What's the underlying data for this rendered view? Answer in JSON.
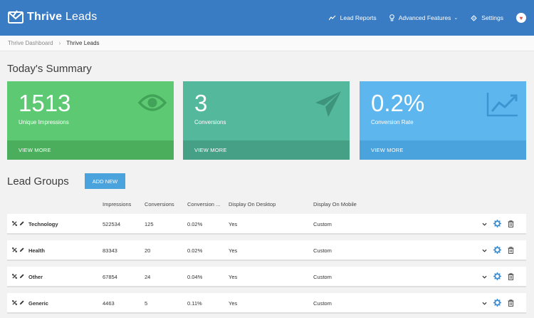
{
  "header": {
    "logo_bold": "Thrive",
    "logo_light": " Leads",
    "nav": [
      {
        "label": "Lead Reports",
        "icon": "chart-line-icon"
      },
      {
        "label": "Advanced Features",
        "icon": "lightbulb-icon"
      },
      {
        "label": "Settings",
        "icon": "gear-icon"
      }
    ],
    "avatar_icon": "heart-icon"
  },
  "breadcrumb": {
    "parent": "Thrive Dashboard",
    "separator": "›",
    "current": "Thrive Leads"
  },
  "summary": {
    "title": "Today's Summary",
    "cards": [
      {
        "value": "1513",
        "label": "Unique Impressions",
        "link": "VIEW MORE",
        "icon": "eye-icon",
        "color": "#5ec973"
      },
      {
        "value": "3",
        "label": "Conversions",
        "link": "VIEW MORE",
        "icon": "paper-plane-icon",
        "color": "#54b89c"
      },
      {
        "value": "0.2%",
        "label": "Conversion Rate",
        "link": "VIEW MORE",
        "icon": "trend-chart-icon",
        "color": "#5db6ee"
      }
    ]
  },
  "lead_groups": {
    "title": "Lead Groups",
    "add_button": "ADD NEW",
    "columns": [
      "Impressions",
      "Conversions",
      "Conversion ...",
      "Display On Desktop",
      "Display On Mobile"
    ],
    "rows": [
      {
        "name": "Technology",
        "impressions": "522534",
        "conversions": "125",
        "rate": "0.02%",
        "desktop": "Yes",
        "mobile": "Custom"
      },
      {
        "name": "Health",
        "impressions": "83343",
        "conversions": "20",
        "rate": "0.02%",
        "desktop": "Yes",
        "mobile": "Custom"
      },
      {
        "name": "Other",
        "impressions": "67854",
        "conversions": "24",
        "rate": "0.04%",
        "desktop": "Yes",
        "mobile": "Custom"
      },
      {
        "name": "Generic",
        "impressions": "4463",
        "conversions": "5",
        "rate": "0.11%",
        "desktop": "Yes",
        "mobile": "Custom"
      }
    ]
  },
  "colors": {
    "header": "#3a7cc3",
    "accent": "#4aa3dd"
  }
}
